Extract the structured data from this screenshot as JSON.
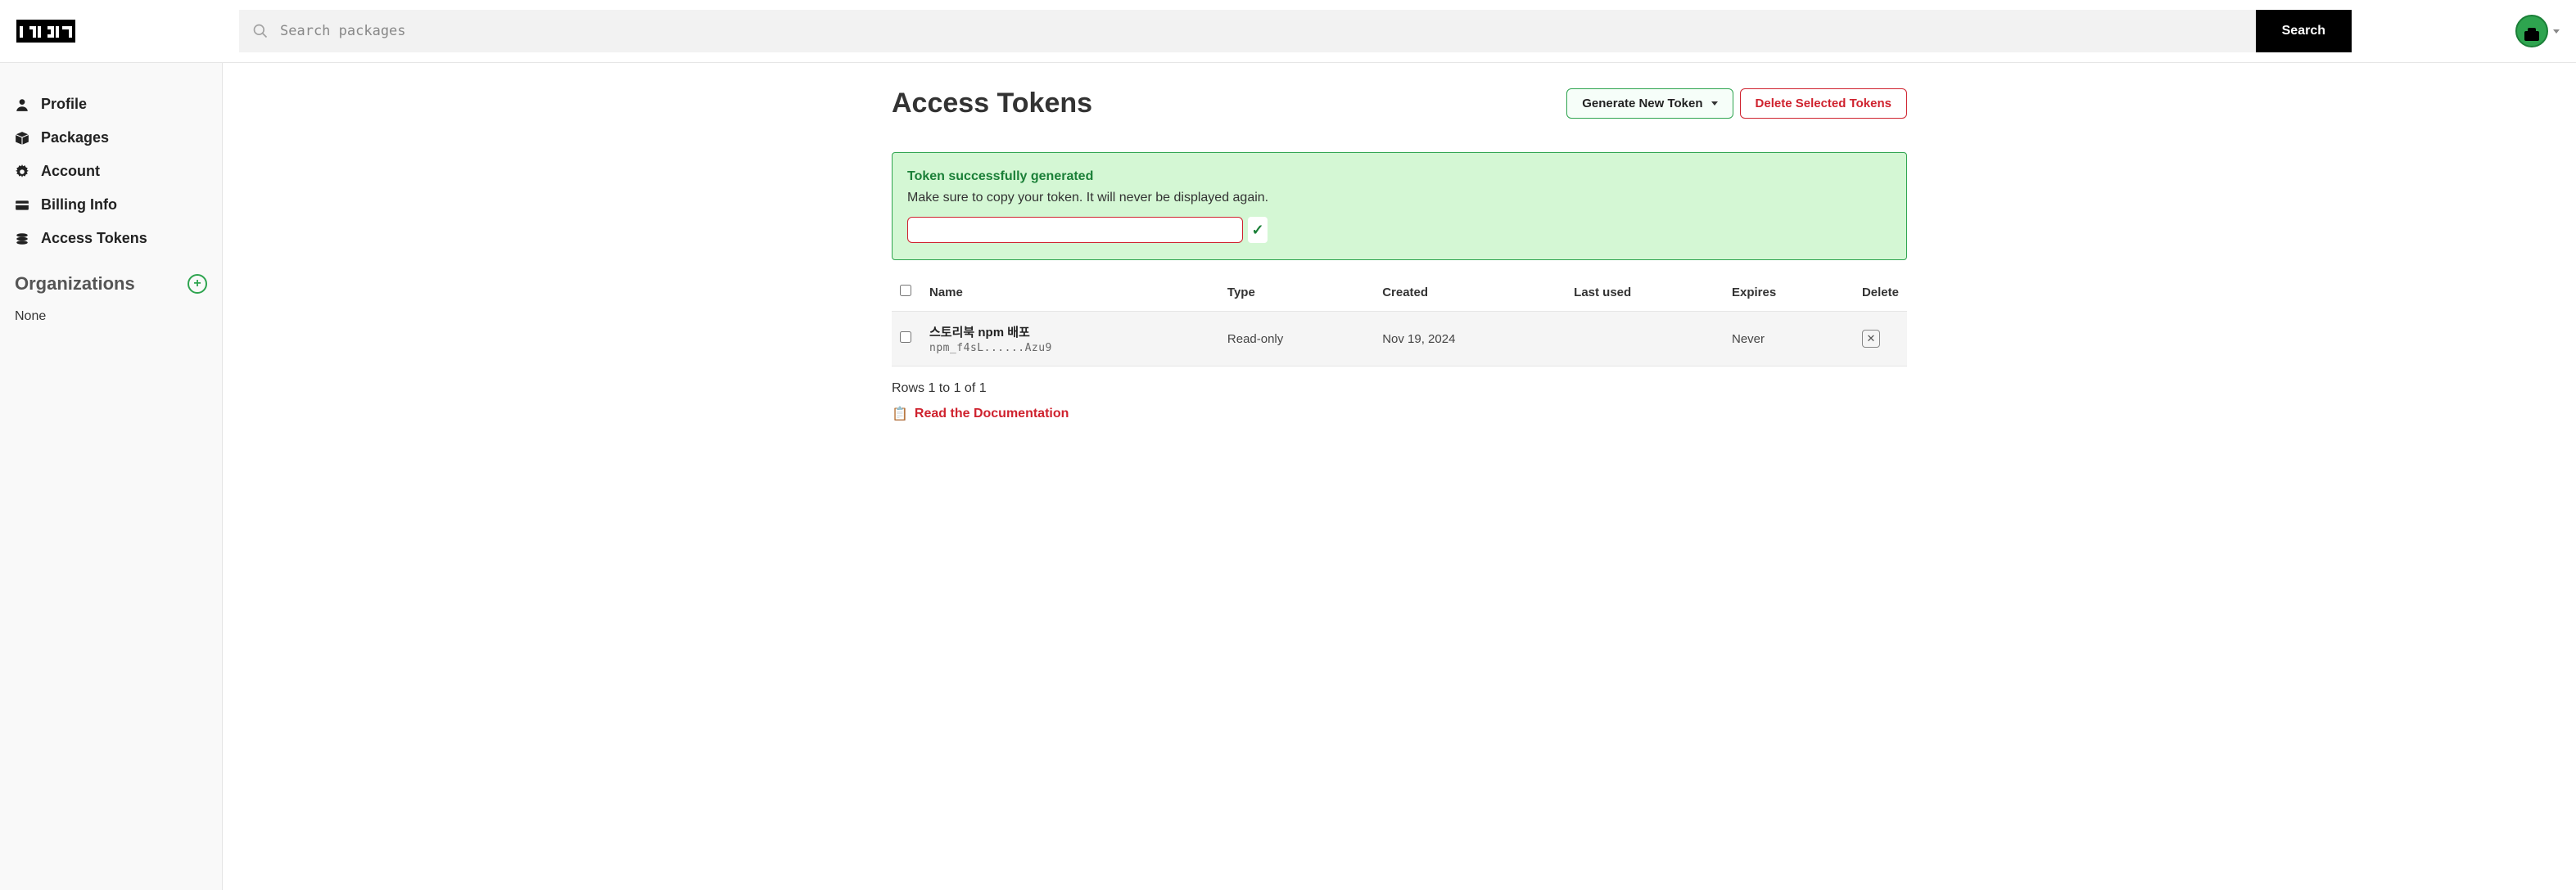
{
  "header": {
    "search_placeholder": "Search packages",
    "search_button": "Search"
  },
  "sidebar": {
    "items": [
      {
        "label": "Profile"
      },
      {
        "label": "Packages"
      },
      {
        "label": "Account"
      },
      {
        "label": "Billing Info"
      },
      {
        "label": "Access Tokens"
      }
    ],
    "org_title": "Organizations",
    "org_none": "None"
  },
  "page": {
    "title": "Access Tokens",
    "generate_btn": "Generate New Token",
    "delete_btn": "Delete Selected Tokens"
  },
  "alert": {
    "title": "Token successfully generated",
    "text": "Make sure to copy your token. It will never be displayed again.",
    "token_value": ""
  },
  "table": {
    "headers": {
      "name": "Name",
      "type": "Type",
      "created": "Created",
      "last_used": "Last used",
      "expires": "Expires",
      "delete": "Delete"
    },
    "rows": [
      {
        "name": "스토리북 npm 배포",
        "token_masked": "npm_f4sL......Azu9",
        "type": "Read-only",
        "created": "Nov 19, 2024",
        "last_used": "",
        "expires": "Never"
      }
    ]
  },
  "footer": {
    "rows_info": "Rows 1 to 1 of 1",
    "doc_link": "Read the Documentation"
  }
}
